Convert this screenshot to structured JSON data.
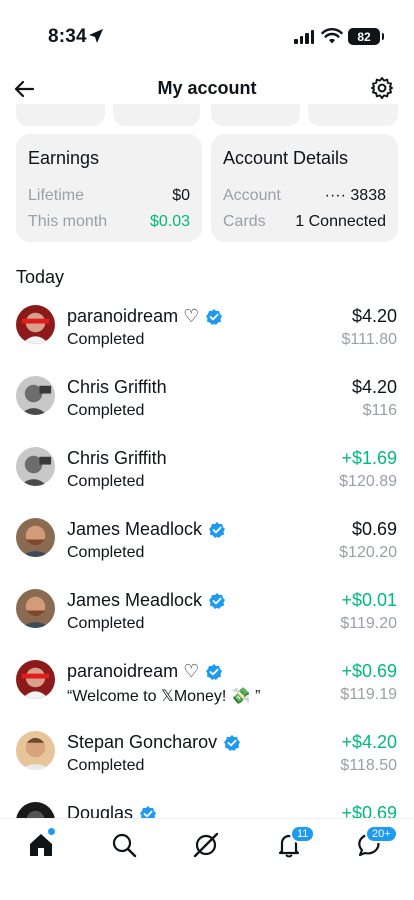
{
  "status": {
    "time": "8:34",
    "battery": "82"
  },
  "header": {
    "title": "My account"
  },
  "earnings": {
    "title": "Earnings",
    "lifetime_label": "Lifetime",
    "lifetime_value": "$0",
    "month_label": "This month",
    "month_value": "$0.03"
  },
  "account": {
    "title": "Account Details",
    "account_label": "Account",
    "account_value": "···· 3838",
    "cards_label": "Cards",
    "cards_value": "1 Connected"
  },
  "section": {
    "today": "Today"
  },
  "transactions": [
    {
      "name": "paranoidream ♡",
      "verified": true,
      "status": "Completed",
      "amount": "$4.20",
      "positive": false,
      "balance": "$111.80"
    },
    {
      "name": "Chris Griffith",
      "verified": false,
      "status": "Completed",
      "amount": "$4.20",
      "positive": false,
      "balance": "$116"
    },
    {
      "name": "Chris Griffith",
      "verified": false,
      "status": "Completed",
      "amount": "+$1.69",
      "positive": true,
      "balance": "$120.89"
    },
    {
      "name": "James Meadlock",
      "verified": true,
      "status": "Completed",
      "amount": "$0.69",
      "positive": false,
      "balance": "$120.20"
    },
    {
      "name": "James Meadlock",
      "verified": true,
      "status": "Completed",
      "amount": "+$0.01",
      "positive": true,
      "balance": "$119.20"
    },
    {
      "name": "paranoidream ♡",
      "verified": true,
      "status": "“Welcome to 𝕏Money! 💸 ”",
      "amount": "+$0.69",
      "positive": true,
      "balance": "$119.19"
    },
    {
      "name": "Stepan Goncharov",
      "verified": true,
      "status": "Completed",
      "amount": "+$4.20",
      "positive": true,
      "balance": "$118.50"
    },
    {
      "name": "Douglas",
      "verified": true,
      "status": "",
      "amount": "+$0.69",
      "positive": true,
      "balance": ""
    }
  ],
  "tabbar": {
    "notifications_badge": "11",
    "messages_badge": "20+"
  },
  "colors": {
    "accent": "#1d9bf0",
    "positive": "#00ba7c",
    "muted": "#9aa0a6",
    "card_bg": "#f2f2f3"
  }
}
